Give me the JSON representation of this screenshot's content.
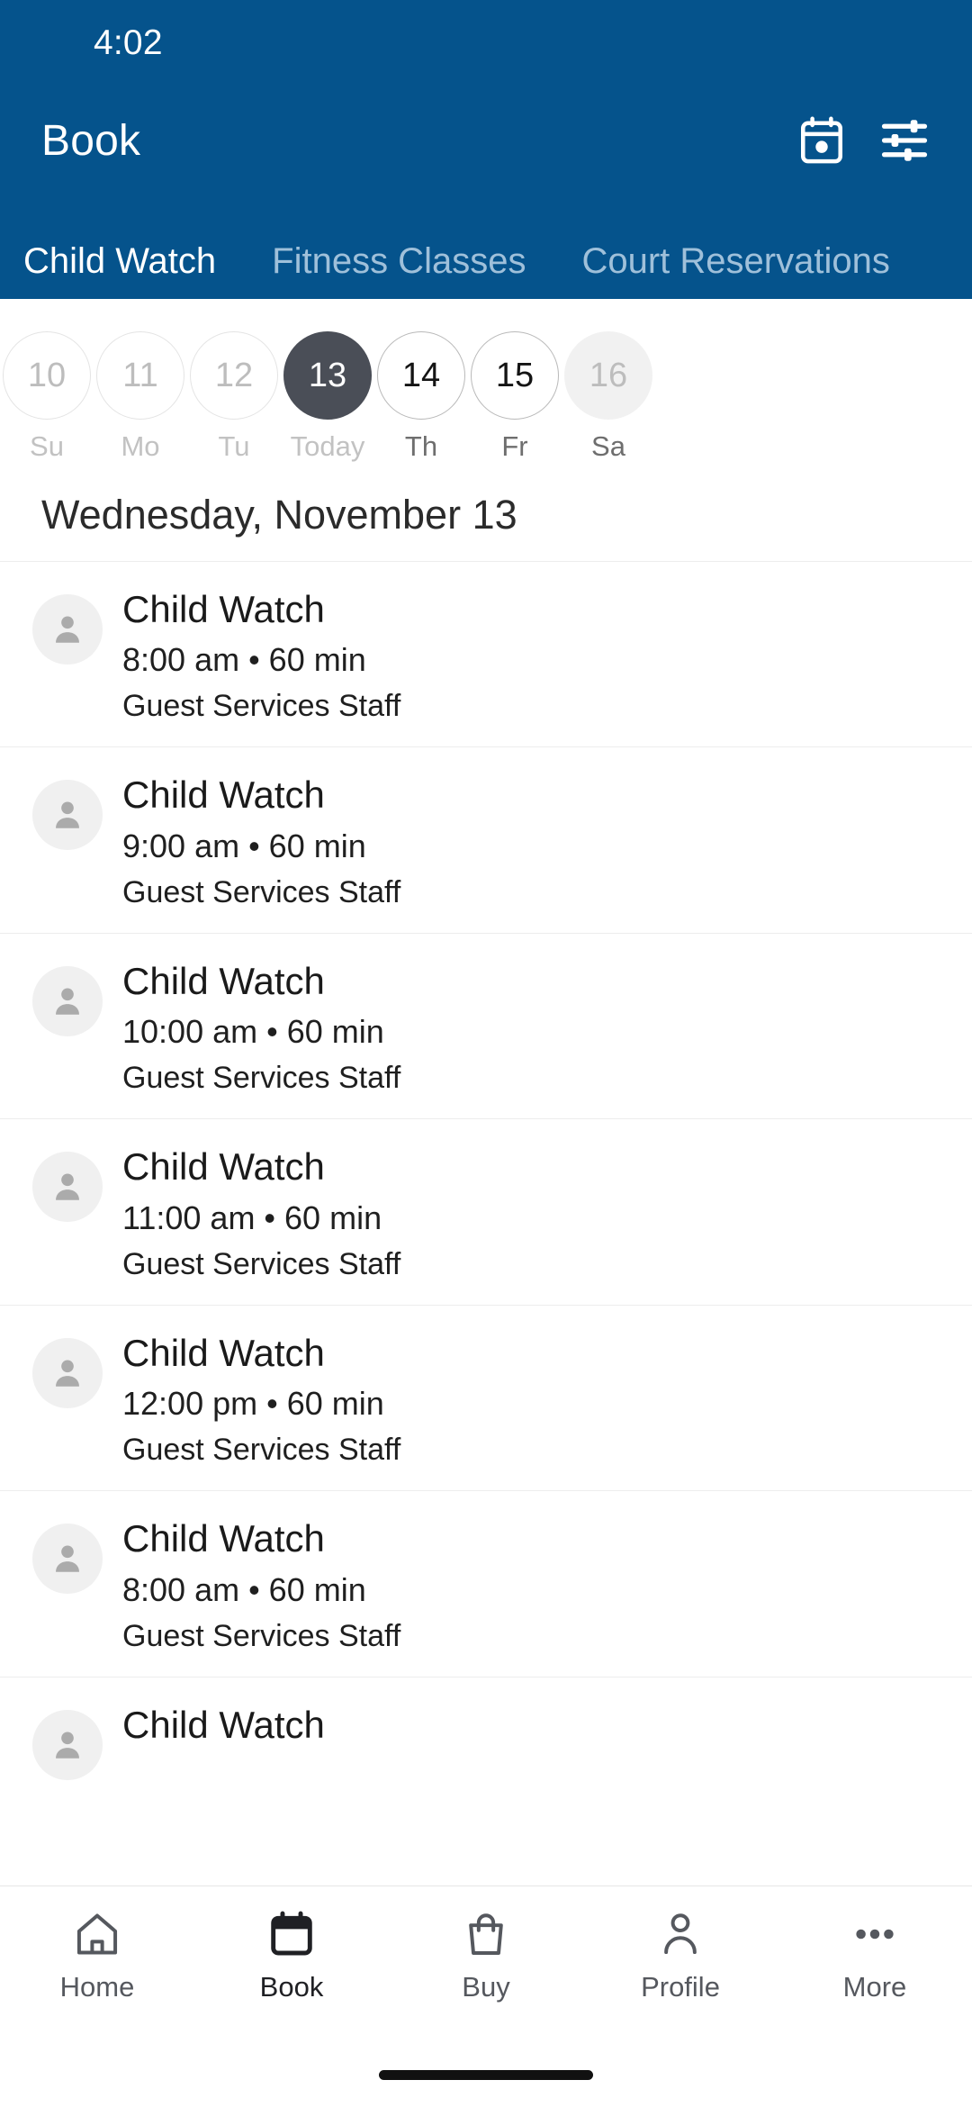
{
  "colors": {
    "brand_blue": "#05538C",
    "tab_inactive": "#9FC0DA",
    "selected_day": "#4A4E57",
    "divider": "#EDEDED",
    "avatar_bg": "#F0F0F0",
    "nav_active": "#1F2024",
    "nav_inactive": "#55585E"
  },
  "status_bar": {
    "time": "4:02"
  },
  "app_bar": {
    "title": "Book",
    "actions": [
      {
        "name": "calendar-icon",
        "label": "Calendar"
      },
      {
        "name": "filter-icon",
        "label": "Filters"
      }
    ]
  },
  "tabs": [
    {
      "label": "Child Watch",
      "active": true
    },
    {
      "label": "Fitness Classes",
      "active": false
    },
    {
      "label": "Court Reservations",
      "active": false
    }
  ],
  "date_strip": [
    {
      "day_number": "10",
      "day_label": "Su",
      "state": "past"
    },
    {
      "day_number": "11",
      "day_label": "Mo",
      "state": "past"
    },
    {
      "day_number": "12",
      "day_label": "Tu",
      "state": "past"
    },
    {
      "day_number": "13",
      "day_label": "Today",
      "state": "selected"
    },
    {
      "day_number": "14",
      "day_label": "Th",
      "state": "available"
    },
    {
      "day_number": "15",
      "day_label": "Fr",
      "state": "available"
    },
    {
      "day_number": "16",
      "day_label": "Sa",
      "state": "unavailable"
    }
  ],
  "day_heading": "Wednesday, November 13",
  "sessions": [
    {
      "title": "Child Watch",
      "time": "8:00 am • 60 min",
      "staff": "Guest Services Staff"
    },
    {
      "title": "Child Watch",
      "time": "9:00 am • 60 min",
      "staff": "Guest Services Staff"
    },
    {
      "title": "Child Watch",
      "time": "10:00 am • 60 min",
      "staff": "Guest Services Staff"
    },
    {
      "title": "Child Watch",
      "time": "11:00 am • 60 min",
      "staff": "Guest Services Staff"
    },
    {
      "title": "Child Watch",
      "time": "12:00 pm • 60 min",
      "staff": "Guest Services Staff"
    },
    {
      "title": "Child Watch",
      "time": "8:00 am • 60 min",
      "staff": "Guest Services Staff"
    },
    {
      "title": "Child Watch",
      "time": "",
      "staff": ""
    }
  ],
  "bottom_nav": [
    {
      "label": "Home",
      "icon": "home-icon",
      "active": false
    },
    {
      "label": "Book",
      "icon": "calendar-icon",
      "active": true
    },
    {
      "label": "Buy",
      "icon": "bag-icon",
      "active": false
    },
    {
      "label": "Profile",
      "icon": "person-icon",
      "active": false
    },
    {
      "label": "More",
      "icon": "more-icon",
      "active": false
    }
  ]
}
